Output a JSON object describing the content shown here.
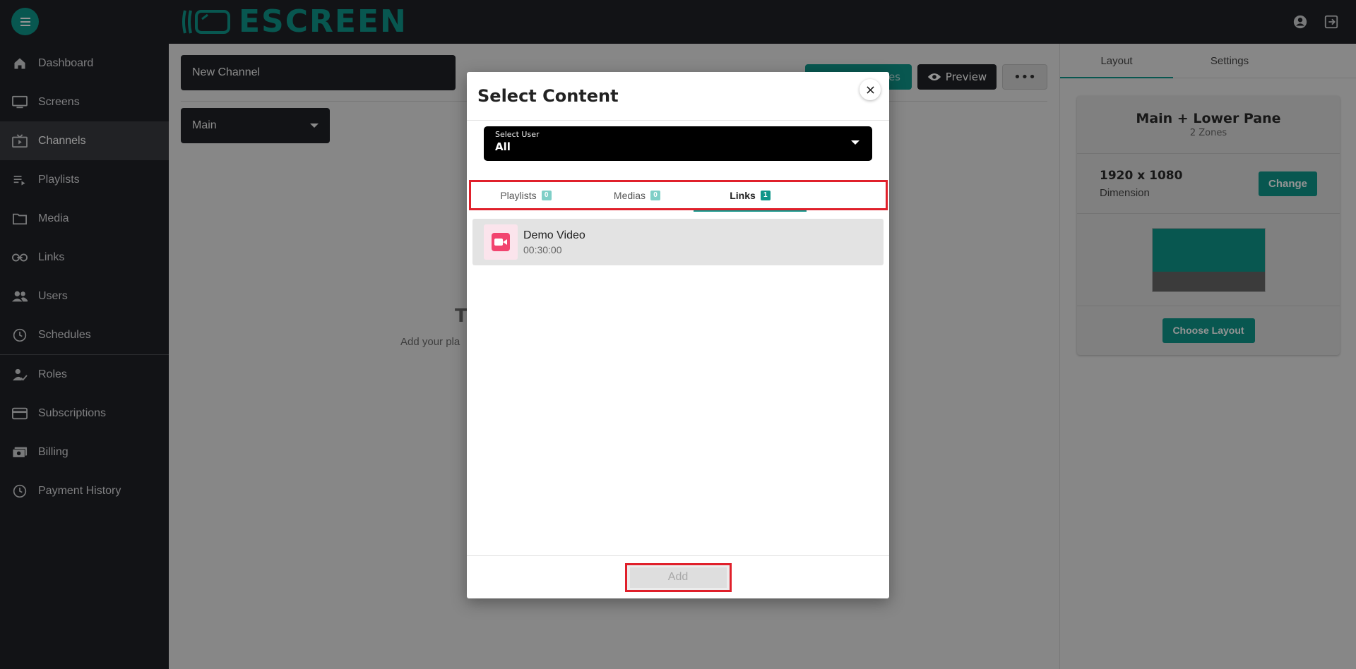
{
  "brand": {
    "name": "ESCREEN",
    "color": "#0f968a"
  },
  "topbar": {
    "icons": [
      "account-circle-icon",
      "logout-icon"
    ]
  },
  "sidebar": {
    "items": [
      {
        "label": "Dashboard",
        "icon": "home-icon"
      },
      {
        "label": "Screens",
        "icon": "monitor-icon"
      },
      {
        "label": "Channels",
        "icon": "tv-icon",
        "active": true
      },
      {
        "label": "Playlists",
        "icon": "playlist-icon"
      },
      {
        "label": "Media",
        "icon": "folder-icon"
      },
      {
        "label": "Links",
        "icon": "link-icon"
      },
      {
        "label": "Users",
        "icon": "users-icon"
      },
      {
        "label": "Schedules",
        "icon": "clock-icon"
      },
      {
        "label": "Roles",
        "icon": "user-check-icon"
      },
      {
        "label": "Subscriptions",
        "icon": "credit-card-icon"
      },
      {
        "label": "Billing",
        "icon": "billing-icon"
      },
      {
        "label": "Payment History",
        "icon": "history-icon"
      }
    ]
  },
  "main": {
    "channel_name": "New Channel",
    "zone_selected": "Main",
    "save_label": "es",
    "preview_label": "Preview",
    "more_label": "•••",
    "empty_title": "T",
    "empty_sub": "Add your pla"
  },
  "right_panel": {
    "tabs": [
      "Layout",
      "Settings"
    ],
    "layout_title": "Main + Lower Pane",
    "layout_sub": "2 Zones",
    "dimension_value": "1920 x 1080",
    "dimension_label": "Dimension",
    "change_label": "Change",
    "choose_layout_label": "Choose Layout"
  },
  "modal": {
    "title": "Select Content",
    "user_select_label": "Select User",
    "user_select_value": "All",
    "tabs": [
      {
        "label": "Playlists",
        "count": "0"
      },
      {
        "label": "Medias",
        "count": "0"
      },
      {
        "label": "Links",
        "count": "1"
      }
    ],
    "items": [
      {
        "name": "Demo Video",
        "duration": "00:30:00"
      }
    ],
    "add_label": "Add"
  }
}
